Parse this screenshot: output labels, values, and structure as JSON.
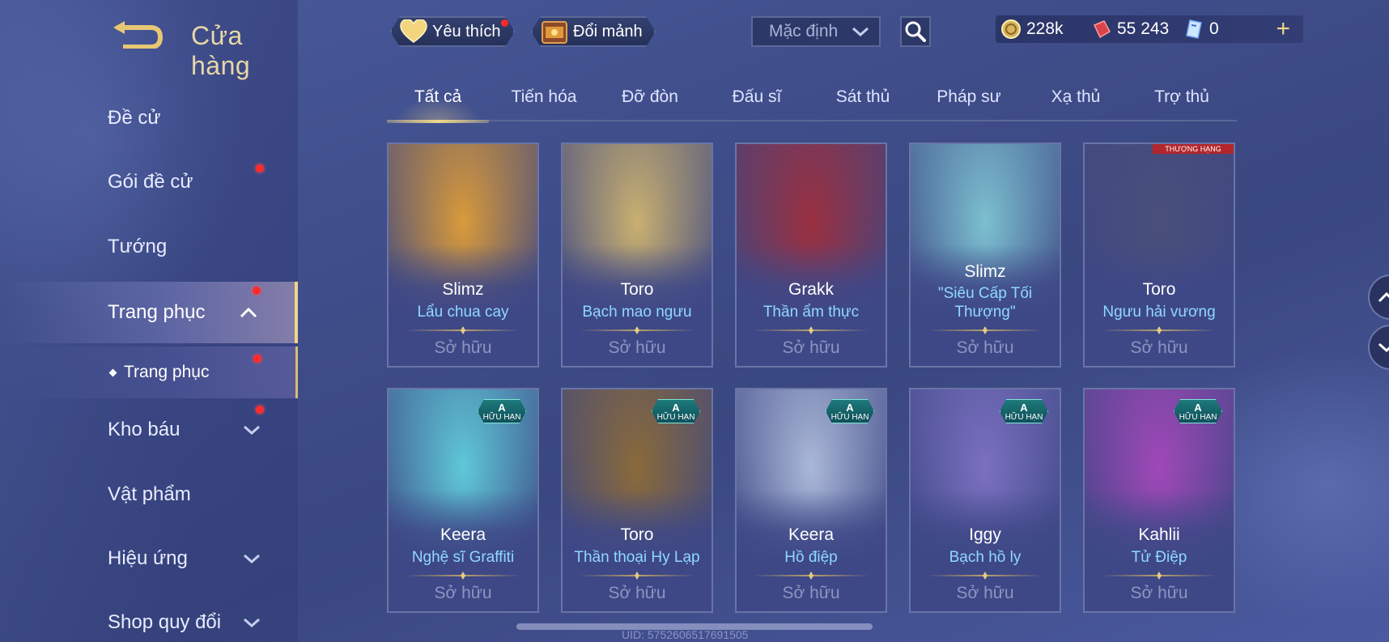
{
  "header": {
    "title": "Cửa hàng",
    "favorites_label": "Yêu thích",
    "exchange_label": "Đổi mảnh",
    "sort_value": "Mặc định"
  },
  "currency": {
    "gold": "228k",
    "vouchers": "55 243",
    "tickets": "0"
  },
  "sidebar": {
    "items": [
      {
        "label": "Đề cử"
      },
      {
        "label": "Gói đề cử"
      },
      {
        "label": "Tướng"
      },
      {
        "label": "Trang phục"
      },
      {
        "label": "Trang phục"
      },
      {
        "label": "Kho báu"
      },
      {
        "label": "Vật phẩm"
      },
      {
        "label": "Hiệu ứng"
      },
      {
        "label": "Shop quy đổi"
      }
    ]
  },
  "tabs": [
    {
      "label": "Tất cả"
    },
    {
      "label": "Tiến hóa"
    },
    {
      "label": "Đỡ đòn"
    },
    {
      "label": "Đấu sĩ"
    },
    {
      "label": "Sát thủ"
    },
    {
      "label": "Pháp sư"
    },
    {
      "label": "Xạ thủ"
    },
    {
      "label": "Trợ thủ"
    }
  ],
  "cards": [
    {
      "hero": "Slimz",
      "skin": "Lẩu chua cay",
      "status": "Sở hữu",
      "color": "#d99a3a"
    },
    {
      "hero": "Toro",
      "skin": "Bạch mao ngưu",
      "status": "Sở hữu",
      "color": "#c9b070"
    },
    {
      "hero": "Grakk",
      "skin": "Thần ẩm thực",
      "status": "Sở hữu",
      "color": "#9b3040"
    },
    {
      "hero": "Slimz",
      "skin": "\"Siêu Cấp Tối Thượng\"",
      "status": "Sở hữu",
      "color": "#7cc0d0"
    },
    {
      "hero": "Toro",
      "skin": "Ngưu hải vương",
      "status": "Sở hữu",
      "color": "#4a4f7a",
      "ribbon": "THƯỢNG HẠNG"
    },
    {
      "hero": "Keera",
      "skin": "Nghệ sĩ Graffiti",
      "status": "Sở hữu",
      "color": "#5fc8d8",
      "badge_grade": "A",
      "badge_text": "HỮU HẠN"
    },
    {
      "hero": "Toro",
      "skin": "Thần thoại Hy Lạp",
      "status": "Sở hữu",
      "color": "#8a6a3a",
      "badge_grade": "A",
      "badge_text": "HỮU HẠN"
    },
    {
      "hero": "Keera",
      "skin": "Hồ điệp",
      "status": "Sở hữu",
      "color": "#aab8d8",
      "badge_grade": "A",
      "badge_text": "HỮU HẠN"
    },
    {
      "hero": "Iggy",
      "skin": "Bạch hồ ly",
      "status": "Sở hữu",
      "color": "#7a70c0",
      "badge_grade": "A",
      "badge_text": "HỮU HẠN"
    },
    {
      "hero": "Kahlii",
      "skin": "Tử Điệp",
      "status": "Sở hữu",
      "color": "#a048b8",
      "badge_grade": "A",
      "badge_text": "HỮU HẠN"
    }
  ],
  "footer": {
    "uid": "UID: 5752606517691505"
  },
  "icons": {
    "back": "back-arrow-icon",
    "heart": "heart-icon",
    "chest": "chest-icon",
    "search": "search-icon",
    "coin": "gold-coin-icon",
    "voucher": "voucher-icon",
    "ticket": "ticket-icon",
    "plus": "plus-icon"
  }
}
